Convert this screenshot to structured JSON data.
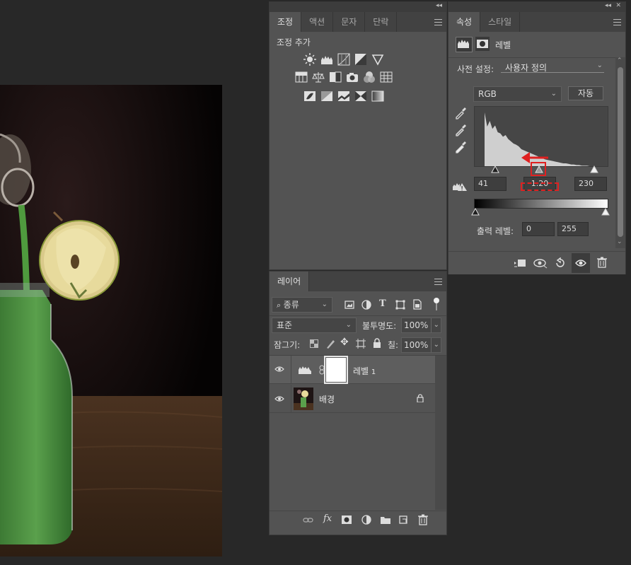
{
  "colors": {
    "panel_bg": "#535353",
    "tab_bg": "#424242",
    "canvas_bg": "#282828",
    "accent_red": "#e02020"
  },
  "adjustments_panel": {
    "tabs": [
      "조정",
      "액션",
      "문자",
      "단락"
    ],
    "active_tab": "조정",
    "heading": "조정 추가",
    "icon_rows": [
      [
        "brightness-contrast-icon",
        "levels-icon",
        "curves-icon",
        "exposure-icon",
        "vibrance-icon"
      ],
      [
        "hue-saturation-icon",
        "color-balance-icon",
        "black-white-icon",
        "photo-filter-icon",
        "channel-mixer-icon",
        "color-lookup-icon"
      ],
      [
        "invert-icon",
        "posterize-icon",
        "threshold-icon",
        "selective-color-icon",
        "gradient-map-icon"
      ]
    ]
  },
  "properties_panel": {
    "tabs": [
      "속성",
      "스타일"
    ],
    "active_tab": "속성",
    "title": "레벨",
    "preset_label": "사전 설정:",
    "preset_value": "사용자 정의",
    "channel_value": "RGB",
    "auto_button": "자동",
    "input_black": "41",
    "input_gamma": "1.20",
    "input_white": "230",
    "output_label": "출력 레벨:",
    "output_black": "0",
    "output_white": "255",
    "histogram_profile": [
      95,
      70,
      80,
      66,
      72,
      60,
      58,
      52,
      55,
      48,
      44,
      40,
      38,
      35,
      30,
      28,
      26,
      24,
      22,
      20,
      18,
      16,
      14,
      12,
      11,
      10,
      9,
      8,
      7,
      6,
      5,
      5,
      4,
      3,
      3,
      2,
      2,
      1,
      1,
      1,
      0,
      0,
      0
    ],
    "input_black_fraction": 0.161,
    "input_gamma_fraction": 0.49,
    "input_white_fraction": 0.902
  },
  "layers_panel": {
    "tab": "레이어",
    "filter_label": "종류",
    "blend_mode": "표준",
    "opacity_label": "불투명도:",
    "opacity_value": "100%",
    "lock_label": "잠그기:",
    "fill_label": "칠:",
    "fill_value": "100%",
    "layers": [
      {
        "name": "레벨",
        "suffix": "1",
        "type": "adjustment",
        "selected": true
      },
      {
        "name": "배경",
        "suffix": "",
        "type": "image",
        "locked": true
      }
    ]
  }
}
